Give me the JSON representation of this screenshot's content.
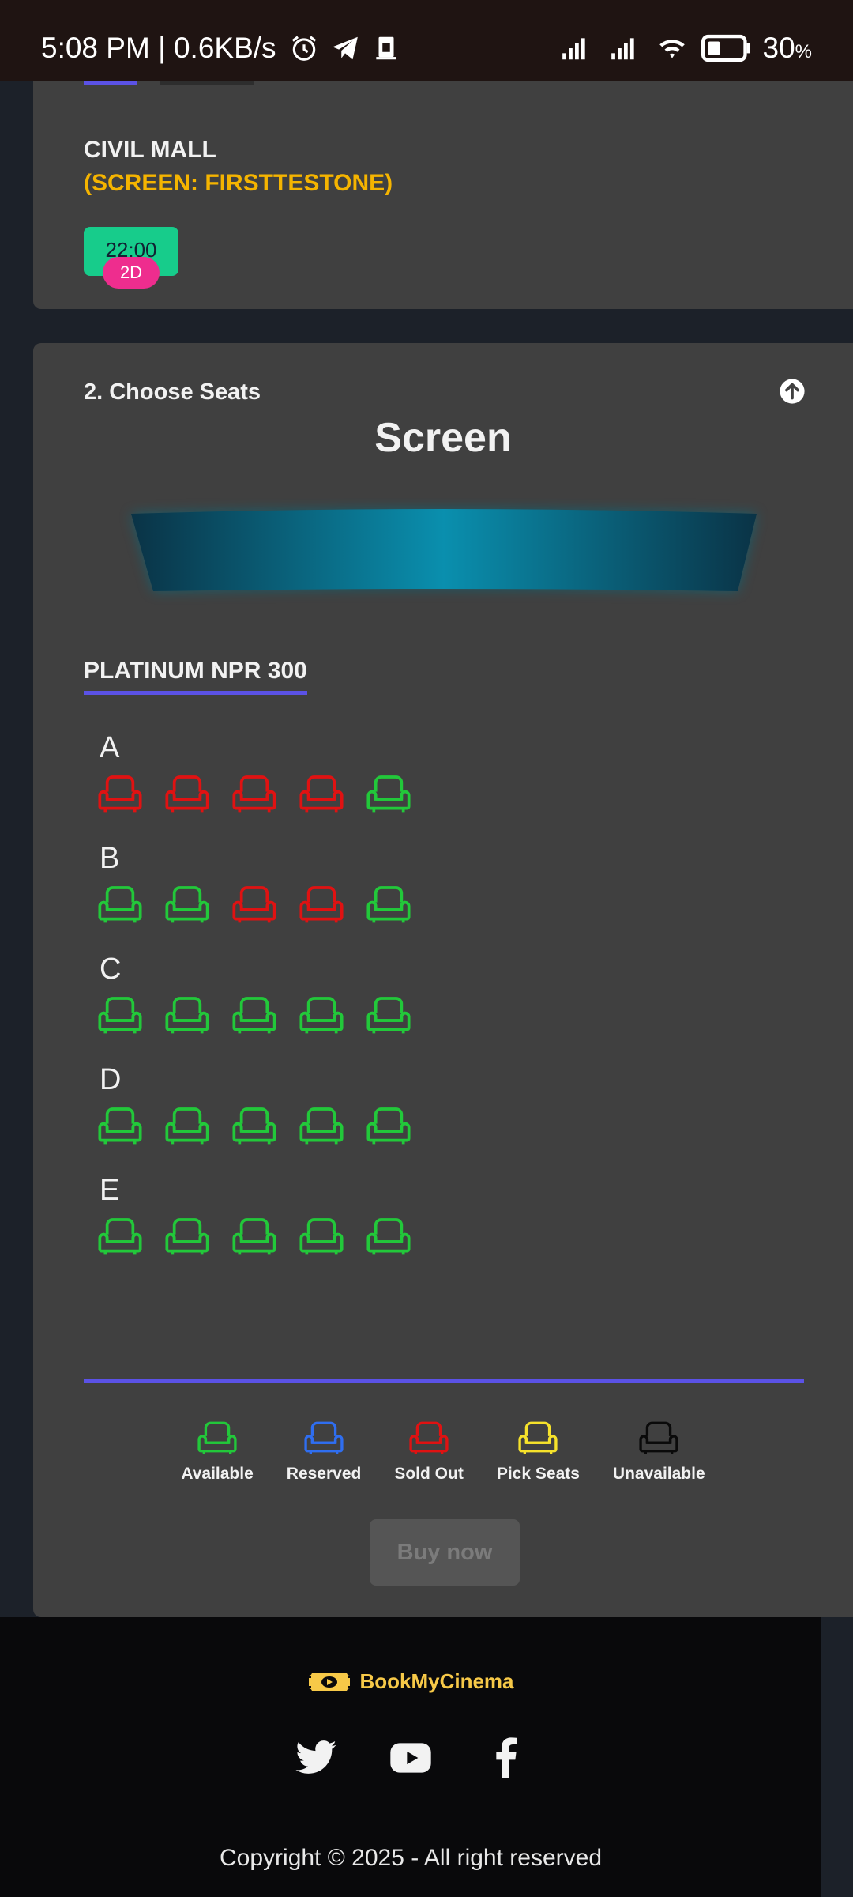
{
  "status_bar": {
    "time_speed": "5:08 PM | 0.6KB/s",
    "battery": "30",
    "battery_unit": "%",
    "icons": [
      "alarm-icon",
      "telegram-icon",
      "sim-card-icon",
      "signal-icon",
      "signal-icon",
      "wifi-icon",
      "battery-icon"
    ]
  },
  "showtime_card": {
    "cinema_name": "CIVIL MALL",
    "screen_name": "(SCREEN: FIRSTTESTONE)",
    "time": "22:00",
    "format": "2D"
  },
  "seats_card": {
    "step_title": "2. Choose Seats",
    "screen_label": "Screen",
    "section_label": "PLATINUM NPR 300",
    "rows": [
      {
        "letter": "A",
        "seats": [
          "sold",
          "sold",
          "sold",
          "sold",
          "available"
        ]
      },
      {
        "letter": "B",
        "seats": [
          "available",
          "available",
          "sold",
          "sold",
          "available"
        ]
      },
      {
        "letter": "C",
        "seats": [
          "available",
          "available",
          "available",
          "available",
          "available"
        ]
      },
      {
        "letter": "D",
        "seats": [
          "available",
          "available",
          "available",
          "available",
          "available"
        ]
      },
      {
        "letter": "E",
        "seats": [
          "available",
          "available",
          "available",
          "available",
          "available"
        ]
      }
    ],
    "legend": [
      {
        "label": "Available",
        "status": "available"
      },
      {
        "label": "Reserved",
        "status": "reserved"
      },
      {
        "label": "Sold Out",
        "status": "sold"
      },
      {
        "label": "Pick Seats",
        "status": "pick"
      },
      {
        "label": "Unavailable",
        "status": "unavailable"
      }
    ],
    "buy_label": "Buy now"
  },
  "colors": {
    "available": "#22c83a",
    "reserved": "#2f6ef0",
    "sold": "#e01212",
    "pick": "#f6e22b",
    "unavailable": "#0a0a0a",
    "accent": "#5b52e6"
  },
  "footer": {
    "brand": "BookMyCinema",
    "socials": [
      "twitter-icon",
      "youtube-icon",
      "facebook-icon"
    ],
    "copyright": "Copyright © 2025 - All right reserved"
  }
}
